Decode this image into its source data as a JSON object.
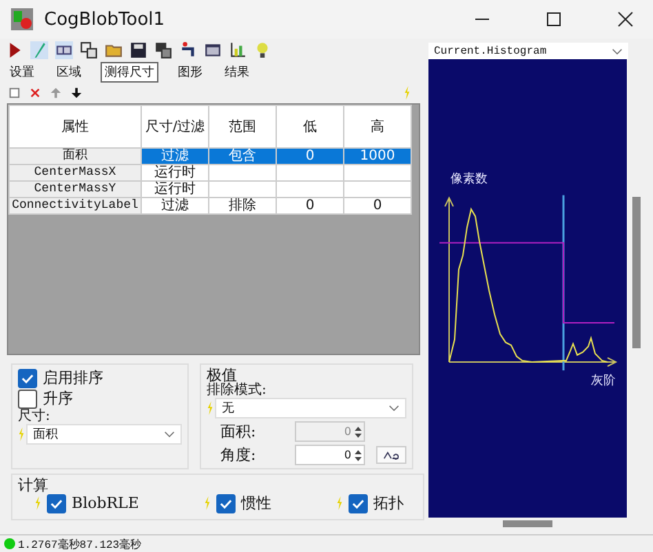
{
  "window": {
    "title": "CogBlobTool1"
  },
  "tabs": [
    {
      "label": "设置",
      "selected": false
    },
    {
      "label": "区域",
      "selected": false
    },
    {
      "label": "测得尺寸",
      "selected": true
    },
    {
      "label": "图形",
      "selected": false
    },
    {
      "label": "结果",
      "selected": false
    }
  ],
  "table": {
    "columns": [
      "属性",
      "尺寸/过滤",
      "范围",
      "低",
      "高"
    ],
    "rows": [
      {
        "property": "面积",
        "mode": "过滤",
        "range": "包含",
        "low": "0",
        "high": "1000",
        "selected": true
      },
      {
        "property": "CenterMassX",
        "mode": "运行时",
        "selected": false
      },
      {
        "property": "CenterMassY",
        "mode": "运行时",
        "selected": false
      },
      {
        "property": "ConnectivityLabel",
        "mode": "过滤",
        "range": "排除",
        "low": "0",
        "high": "0",
        "selected": false
      }
    ]
  },
  "sorting": {
    "enable": {
      "label": "启用排序",
      "checked": true
    },
    "ascending": {
      "label": "升序",
      "checked": false
    },
    "size_label": "尺寸:",
    "size_value": "面积"
  },
  "extremes": {
    "title": "极值",
    "mode_label": "排除模式:",
    "mode_value": "无",
    "area_label": "面积:",
    "area_value": "0",
    "area_disabled": true,
    "angle_label": "角度:",
    "angle_value": "0"
  },
  "compute": {
    "title": "计算",
    "options": [
      {
        "label": "BlobRLE",
        "checked": true
      },
      {
        "label": "惯性",
        "checked": true
      },
      {
        "label": "拓扑",
        "checked": true
      }
    ]
  },
  "status_bar": {
    "text": "1.2767毫秒87.123毫秒"
  },
  "histogram": {
    "source": "Current.Histogram",
    "ylabel": "像素数",
    "xlabel": "灰阶"
  }
}
